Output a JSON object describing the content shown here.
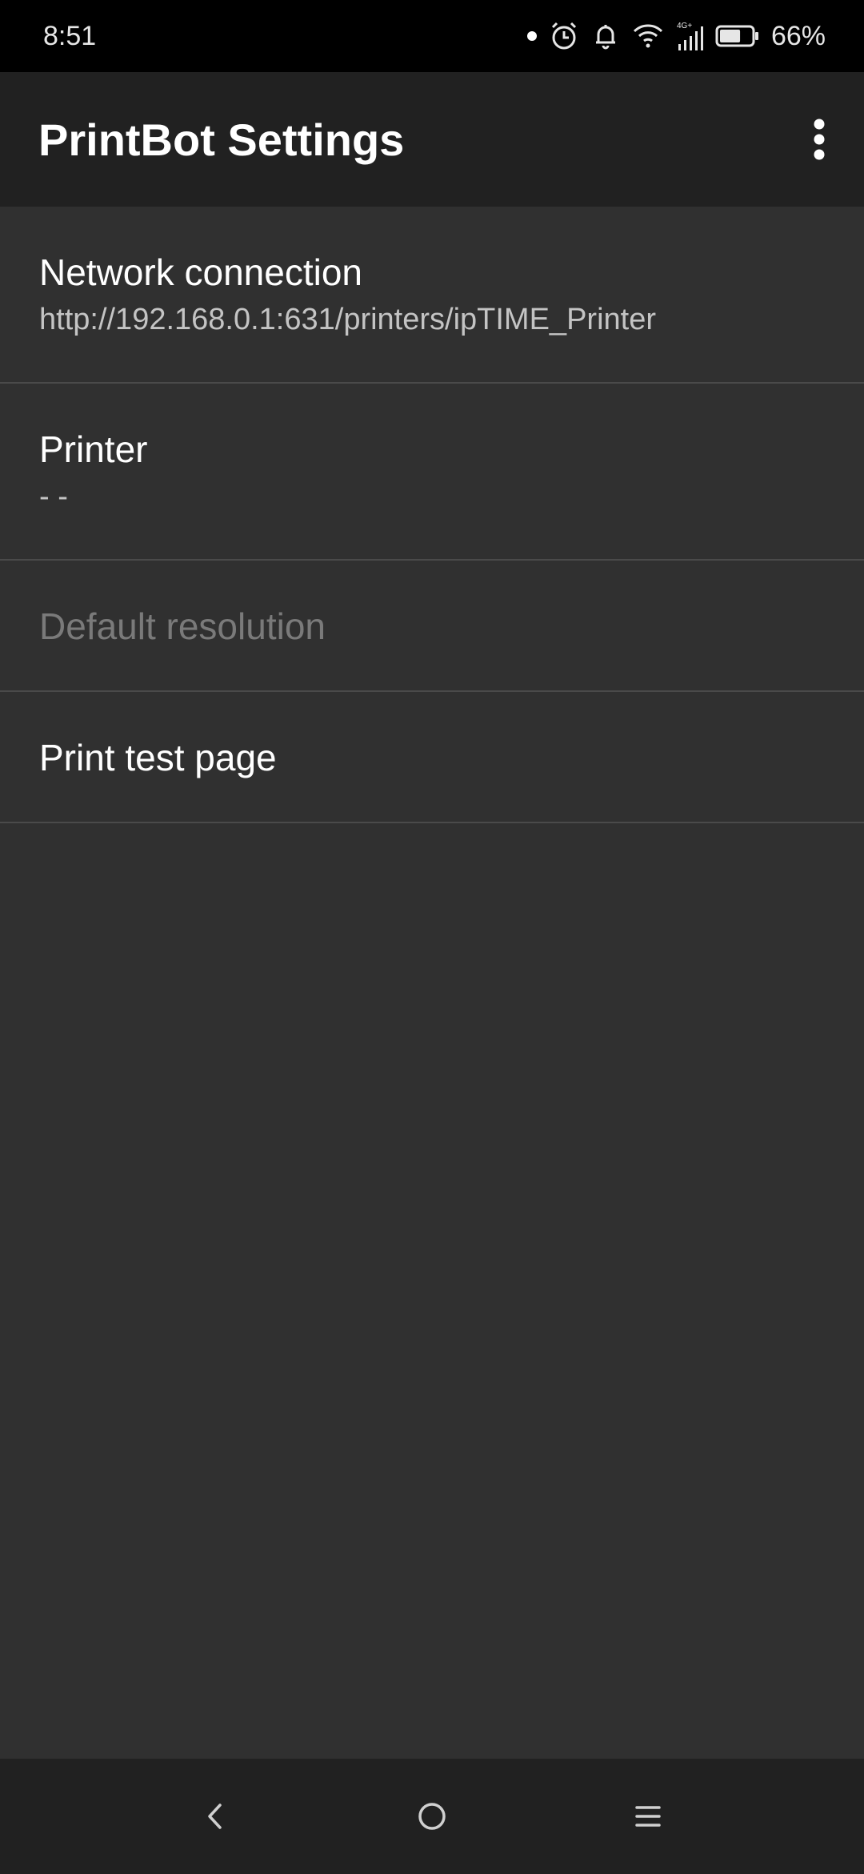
{
  "status_bar": {
    "time": "8:51",
    "battery_percent": "66%",
    "icons": [
      "notification-dot-icon",
      "alarm-icon",
      "bell-icon",
      "wifi-icon",
      "signal-4g-icon",
      "battery-icon"
    ],
    "network_badge": "4G+",
    "battery_level": 0.66
  },
  "app_bar": {
    "title": "PrintBot Settings",
    "overflow_icon": "more-vert-icon"
  },
  "preferences": [
    {
      "title": "Network connection",
      "summary": "http://192.168.0.1:631/printers/ipTIME_Printer",
      "enabled": true
    },
    {
      "title": "Printer",
      "summary": "- -",
      "enabled": true
    },
    {
      "title": "Default resolution",
      "summary": "",
      "enabled": false
    },
    {
      "title": "Print test page",
      "summary": "",
      "enabled": true
    }
  ],
  "nav_bar": {
    "icons": [
      "back-icon",
      "home-icon",
      "recents-icon"
    ]
  },
  "colors": {
    "status_bar_bg": "#000000",
    "app_bar_bg": "#212121",
    "content_bg": "#303030",
    "divider": "#4a4a4a",
    "title_text": "#ffffff",
    "summary_text": "#c4c4c4",
    "disabled_text": "#7a7a7a"
  }
}
